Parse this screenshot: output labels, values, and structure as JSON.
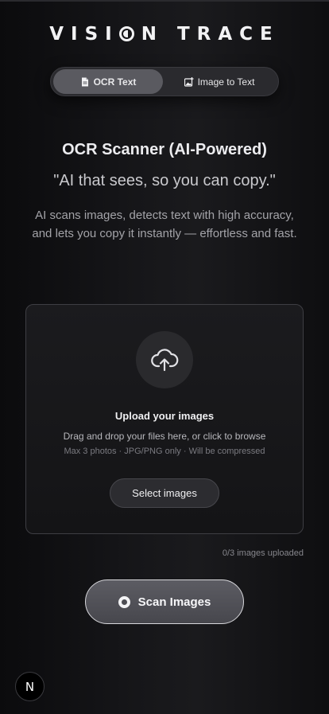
{
  "brand": {
    "logo_pre": "VISI",
    "logo_post": "N TRACE"
  },
  "tabs": [
    {
      "label": "OCR Text",
      "icon": "document-icon",
      "active": true
    },
    {
      "label": "Image to Text",
      "icon": "image-plus-icon",
      "active": false
    }
  ],
  "hero": {
    "title": "OCR Scanner (AI-Powered)",
    "tagline": "\"AI that sees, so you can copy.\"",
    "description": "AI scans images, detects text with high accuracy, and lets you copy it instantly — effortless and fast."
  },
  "upload": {
    "icon": "cloud-upload-icon",
    "title": "Upload your images",
    "instructions": "Drag and drop your files here, or click to browse",
    "limits": "Max 3 photos · JPG/PNG only · Will be compressed",
    "button_label": "Select images",
    "count_text": "0/3 images uploaded"
  },
  "actions": {
    "scan_label": "Scan Images"
  },
  "badge": {
    "label": "N"
  },
  "colors": {
    "background": "#0c0c0e",
    "accent_button": "#55555b",
    "active_tab": "#5a5a60"
  }
}
